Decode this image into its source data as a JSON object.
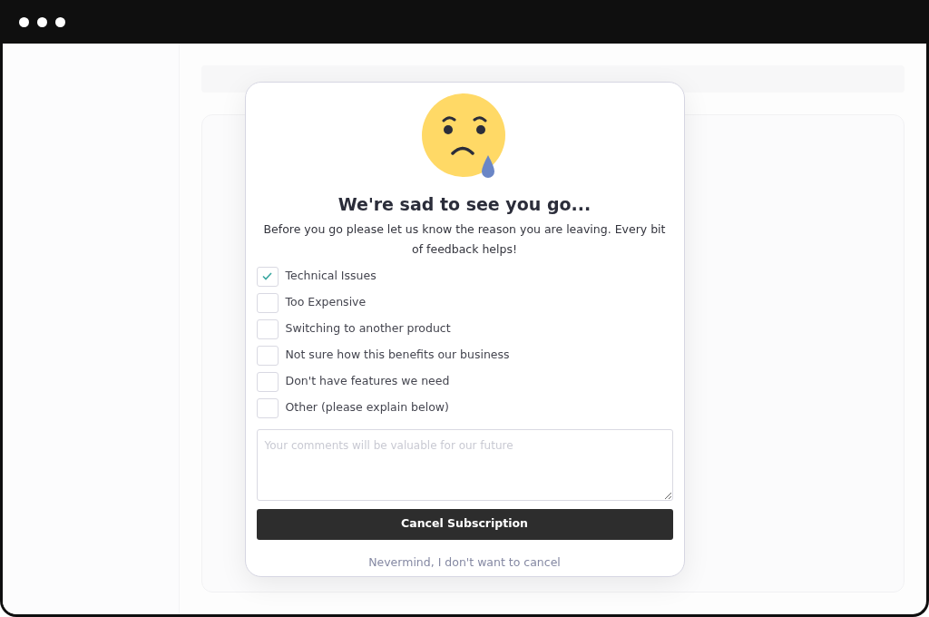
{
  "dialog": {
    "title": "We're sad to see you go...",
    "description": "Before you go please let us know the reason you are leaving. Every bit of feedback helps!",
    "reasons": [
      {
        "label": "Technical Issues",
        "checked": true
      },
      {
        "label": "Too Expensive",
        "checked": false
      },
      {
        "label": "Switching to another product",
        "checked": false
      },
      {
        "label": "Not sure how this benefits our business",
        "checked": false
      },
      {
        "label": "Don't have features we need",
        "checked": false
      },
      {
        "label": "Other (please explain below)",
        "checked": false
      }
    ],
    "comments": {
      "placeholder": "Your comments will be valuable for our future"
    },
    "primary_button": "Cancel Subscription",
    "secondary_link": "Nevermind, I don't want to cancel"
  }
}
